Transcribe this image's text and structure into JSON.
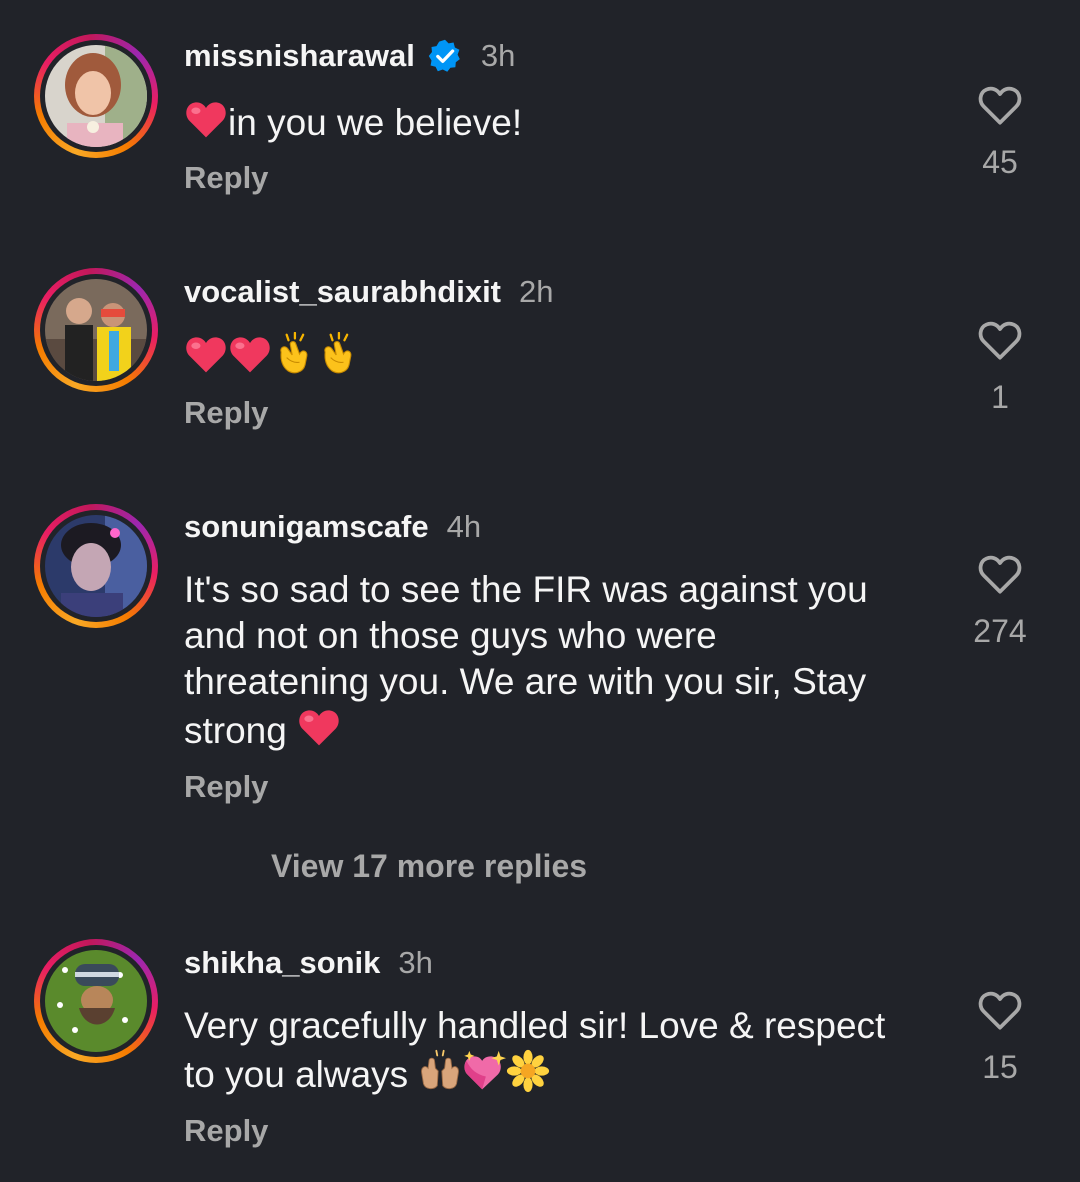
{
  "colors": {
    "background": "#212329",
    "text": "#f5f5f5",
    "muted": "#a8a8a8",
    "verified_blue": "#0095f6"
  },
  "comments": [
    {
      "username": "missnisharawal",
      "verified": true,
      "time": "3h",
      "text": "in you we believe!",
      "reply": "Reply",
      "likes": "45",
      "icons": [
        "red-heart-icon"
      ]
    },
    {
      "username": "vocalist_saurabhdixit",
      "verified": false,
      "time": "2h",
      "text": "",
      "reply": "Reply",
      "likes": "1",
      "icons": [
        "red-heart-icon",
        "red-heart-icon",
        "clapping-hands-icon",
        "clapping-hands-icon"
      ]
    },
    {
      "username": "sonunigamscafe",
      "verified": false,
      "time": "4h",
      "text_lines": [
        "It's so sad to see the FIR was against you",
        "and not on those guys who were",
        "threatening you.  We are with you sir, Stay",
        "strong"
      ],
      "reply": "Reply",
      "likes": "274",
      "icons": [
        "red-heart-icon"
      ]
    },
    {
      "username": "shikha_sonik",
      "verified": false,
      "time": "3h",
      "text_lines": [
        "Very gracefully handled sir! Love & respect",
        "to you always"
      ],
      "reply": "Reply",
      "likes": "15",
      "icons": [
        "raising-hands-icon",
        "sparkling-heart-icon",
        "blossom-icon"
      ]
    }
  ],
  "view_more_replies": "View 17 more replies"
}
